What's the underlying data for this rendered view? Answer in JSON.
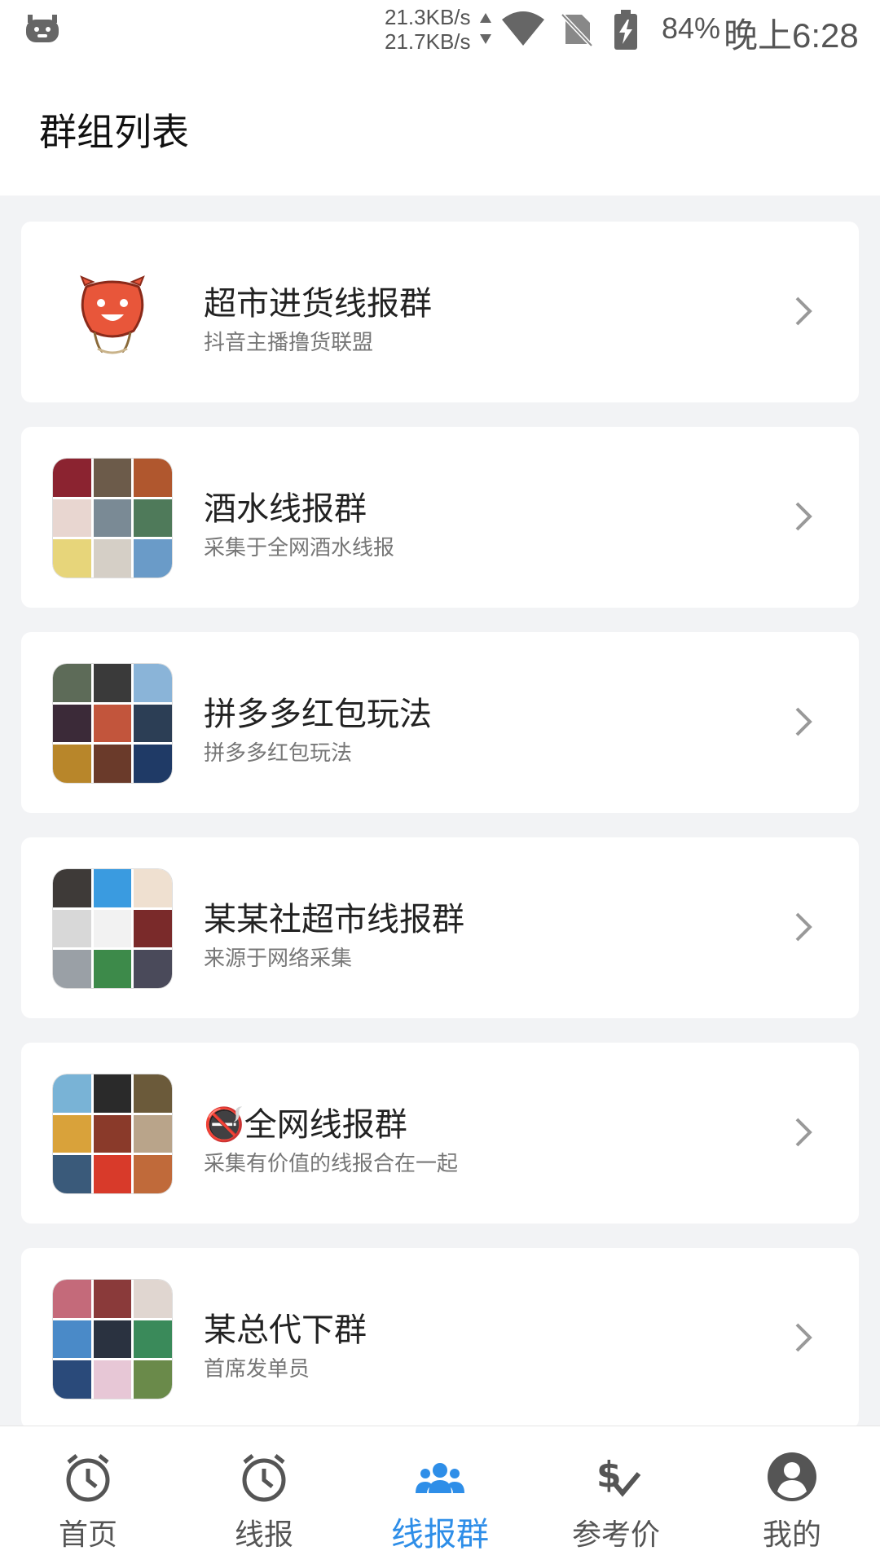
{
  "status_bar": {
    "speed_up": "21.3KB/s",
    "speed_down": "21.7KB/s",
    "battery_percent": "84%",
    "time": "晚上6:28",
    "icons": [
      "app-icon",
      "wifi-icon",
      "no-sim-icon",
      "battery-charging-icon"
    ]
  },
  "header": {
    "title": "群组列表"
  },
  "groups": [
    {
      "name": "超市进货线报群",
      "desc": "抖音主播撸货联盟",
      "avatar": "watermelon-mascot"
    },
    {
      "name": "酒水线报群",
      "desc": "采集于全网酒水线报",
      "avatar": "grid"
    },
    {
      "name": "拼多多红包玩法",
      "desc": "拼多多红包玩法",
      "avatar": "grid"
    },
    {
      "name": "某某社超市线报群",
      "desc": "来源于网络采集",
      "avatar": "grid"
    },
    {
      "name": "🚭全网线报群",
      "desc": "采集有价值的线报合在一起",
      "avatar": "grid"
    },
    {
      "name": "某总代下群",
      "desc": "首席发单员",
      "avatar": "grid"
    }
  ],
  "nav": {
    "items": [
      {
        "label": "首页",
        "icon": "alarm-clock-icon"
      },
      {
        "label": "线报",
        "icon": "alarm-clock-icon"
      },
      {
        "label": "线报群",
        "icon": "group-icon"
      },
      {
        "label": "参考价",
        "icon": "dollar-check-icon"
      },
      {
        "label": "我的",
        "icon": "account-icon"
      }
    ],
    "active_index": 2,
    "active_color": "#2e8ee8"
  }
}
